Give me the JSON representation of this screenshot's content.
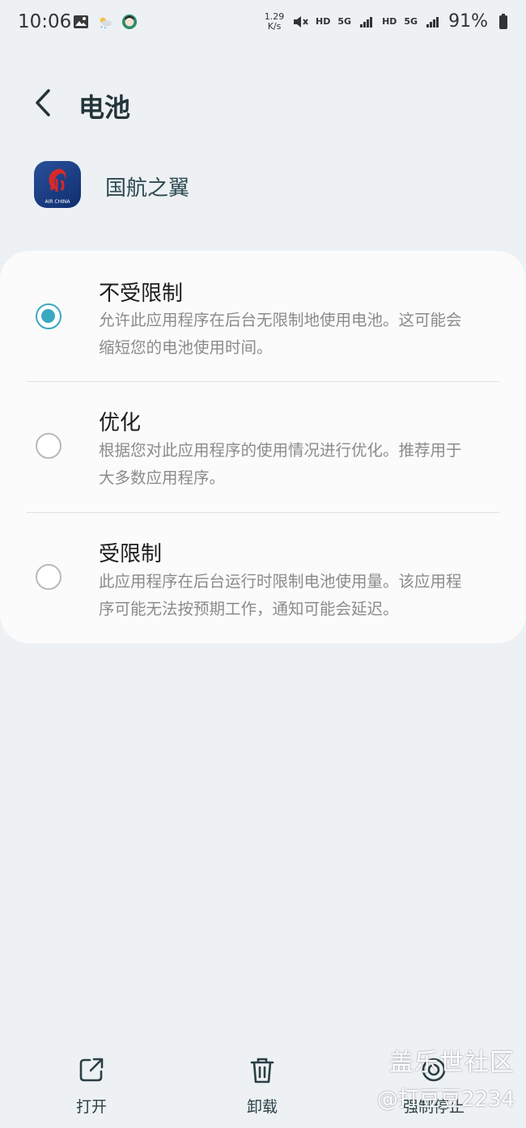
{
  "status_bar": {
    "time": "10:06",
    "net_speed_value": "1.29",
    "net_speed_unit": "K/s",
    "hd1": "HD",
    "fiveg1": "5G",
    "hd2": "HD",
    "fiveg2": "5G",
    "battery": "91%"
  },
  "header": {
    "title": "电池"
  },
  "app": {
    "name": "国航之翼",
    "icon_text": "AIR CHINA"
  },
  "options": [
    {
      "title": "不受限制",
      "desc": "允许此应用程序在后台无限制地使用电池。这可能会缩短您的电池使用时间。",
      "selected": true
    },
    {
      "title": "优化",
      "desc": "根据您对此应用程序的使用情况进行优化。推荐用于大多数应用程序。",
      "selected": false
    },
    {
      "title": "受限制",
      "desc": "此应用程序在后台运行时限制电池使用量。该应用程序可能无法按预期工作，通知可能会延迟。",
      "selected": false
    }
  ],
  "bottom": {
    "open": "打开",
    "uninstall": "卸载",
    "force_stop": "强制停止"
  },
  "watermark": {
    "line1": "盖乐世社区",
    "line2": "@打豆豆2234"
  },
  "colors": {
    "accent": "#3aa8c1",
    "background": "#edf1f4",
    "card": "#fbfbfc"
  }
}
